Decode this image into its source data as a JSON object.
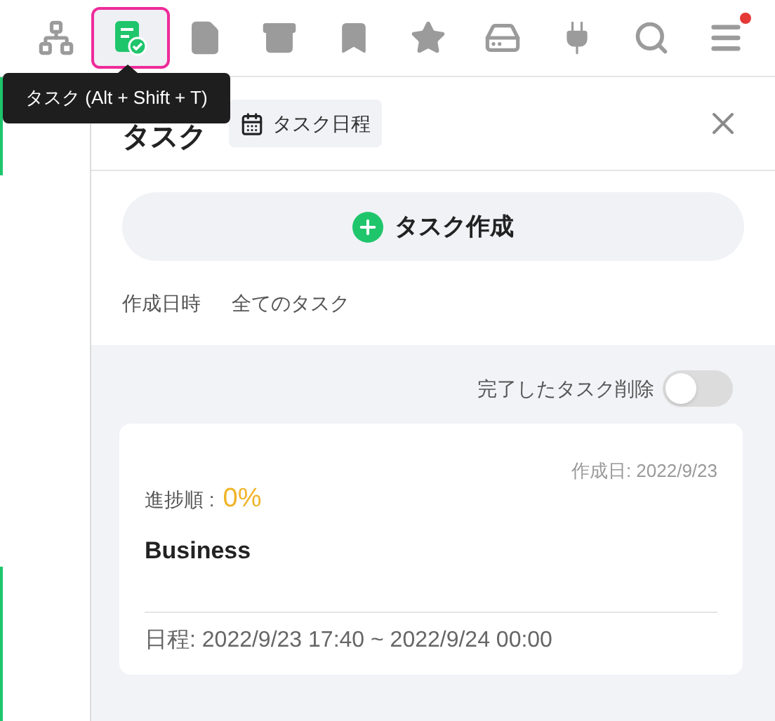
{
  "toolbar": [
    {
      "kind": "sitemap",
      "selected": false
    },
    {
      "kind": "task",
      "selected": true
    },
    {
      "kind": "file",
      "selected": false
    },
    {
      "kind": "archive",
      "selected": false
    },
    {
      "kind": "bookmark",
      "selected": false
    },
    {
      "kind": "star",
      "selected": false
    },
    {
      "kind": "drive",
      "selected": false
    },
    {
      "kind": "plug",
      "selected": false
    },
    {
      "kind": "search",
      "selected": false
    },
    {
      "kind": "menu",
      "selected": false,
      "notification": true
    }
  ],
  "tooltip": "タスク (Alt + Shift + T)",
  "panel": {
    "title": "タスク",
    "schedule_button": "タスク日程",
    "create_button": "タスク作成",
    "filters": [
      "作成日時",
      "全てのタスク"
    ],
    "delete_completed": {
      "label": "完了したタスク削除",
      "on": false
    },
    "tasks": [
      {
        "created": "作成日: 2022/9/23",
        "progress_label": "進捗順 :",
        "progress": "0%",
        "title": "Business",
        "schedule": "日程: 2022/9/23 17:40 ~ 2022/9/24 00:00"
      }
    ]
  }
}
